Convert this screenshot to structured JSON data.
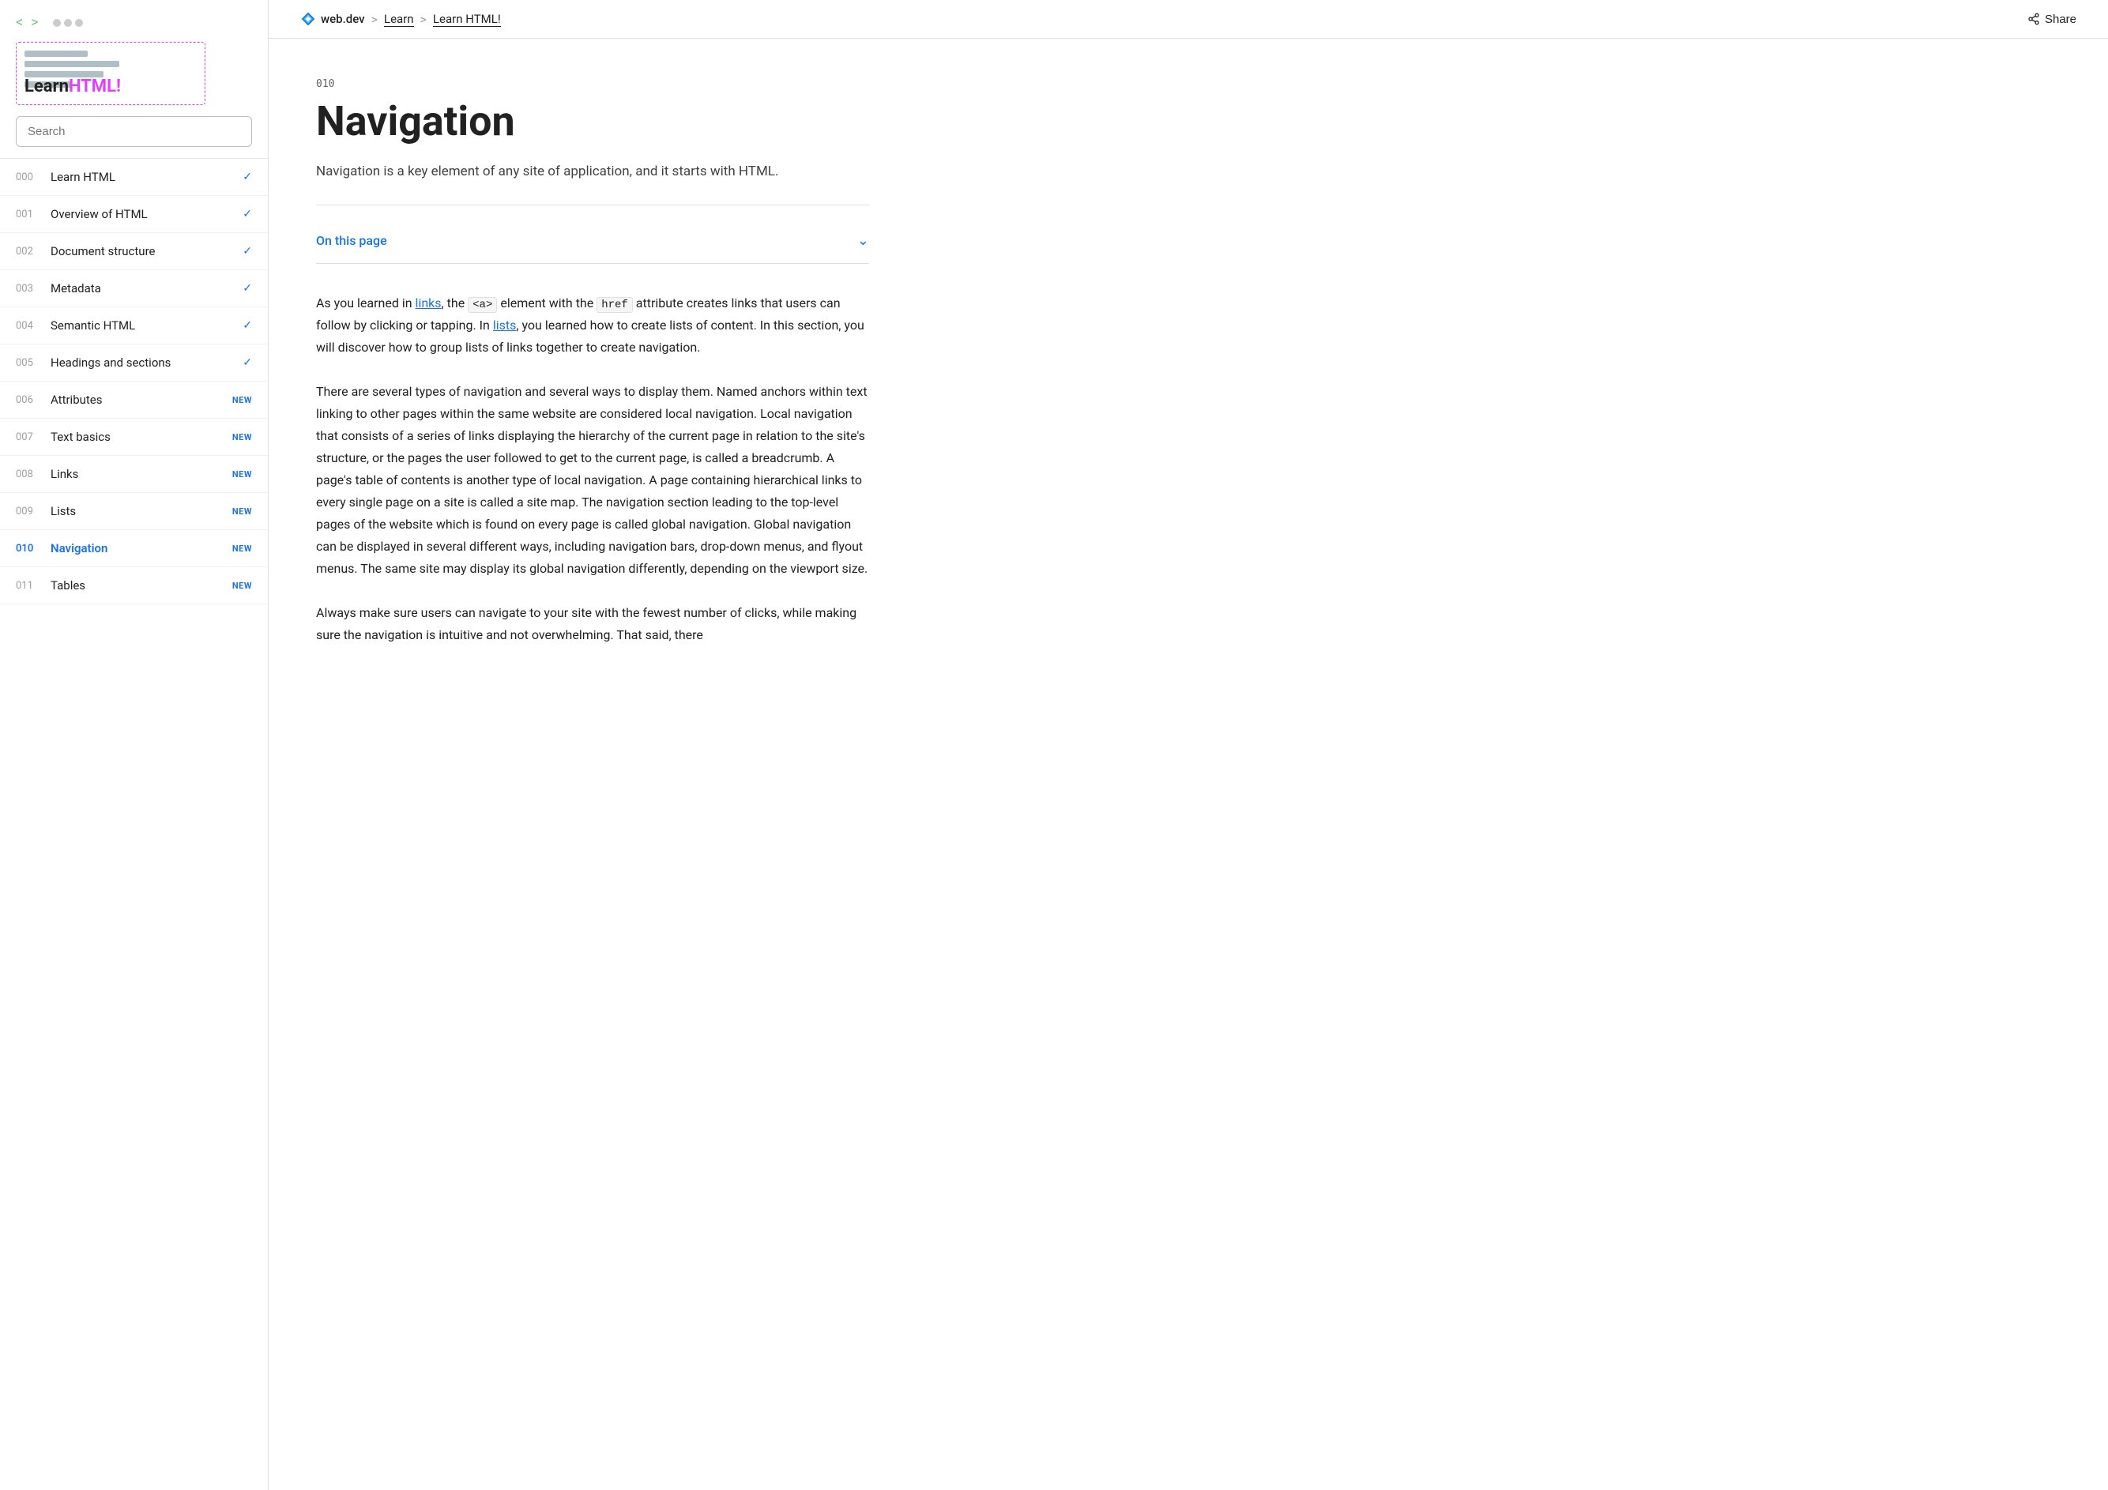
{
  "topbar": {
    "brand": "web.dev",
    "breadcrumb_sep1": ">",
    "breadcrumb_learn": "Learn",
    "breadcrumb_sep2": ">",
    "breadcrumb_course": "Learn HTML!",
    "share_label": "Share"
  },
  "sidebar": {
    "logo_learn": "Learn",
    "logo_html": "HTML!",
    "search_placeholder": "Search",
    "nav_items": [
      {
        "num": "000",
        "label": "Learn HTML",
        "status": "check"
      },
      {
        "num": "001",
        "label": "Overview of HTML",
        "status": "check"
      },
      {
        "num": "002",
        "label": "Document structure",
        "status": "check"
      },
      {
        "num": "003",
        "label": "Metadata",
        "status": "check"
      },
      {
        "num": "004",
        "label": "Semantic HTML",
        "status": "check"
      },
      {
        "num": "005",
        "label": "Headings and sections",
        "status": "check"
      },
      {
        "num": "006",
        "label": "Attributes",
        "status": "new"
      },
      {
        "num": "007",
        "label": "Text basics",
        "status": "new"
      },
      {
        "num": "008",
        "label": "Links",
        "status": "new"
      },
      {
        "num": "009",
        "label": "Lists",
        "status": "new"
      },
      {
        "num": "010",
        "label": "Navigation",
        "status": "new",
        "active": true
      },
      {
        "num": "011",
        "label": "Tables",
        "status": "new"
      }
    ]
  },
  "content": {
    "lesson_num": "010",
    "title": "Navigation",
    "subtitle": "Navigation is a key element of any site of application, and it starts with HTML.",
    "on_this_page": "On this page",
    "body1": "As you learned in links, the <a> element with the href attribute creates links that users can follow by clicking or tapping. In lists, you learned how to create lists of content. In this section, you will discover how to group lists of links together to create navigation.",
    "body2": "There are several types of navigation and several ways to display them. Named anchors within text linking to other pages within the same website are considered local navigation. Local navigation that consists of a series of links displaying the hierarchy of the current page in relation to the site's structure, or the pages the user followed to get to the current page, is called a breadcrumb. A page's table of contents is another type of local navigation. A page containing hierarchical links to every single page on a site is called a site map. The navigation section leading to the top-level pages of the website which is found on every page is called global navigation. Global navigation can be displayed in several different ways, including navigation bars, drop-down menus, and flyout menus. The same site may display its global navigation differently, depending on the viewport size.",
    "body3": "Always make sure users can navigate to your site with the fewest number of clicks, while making sure the navigation is intuitive and not overwhelming. That said, there",
    "inline_link1": "links",
    "inline_link2": "lists",
    "code1": "<a>",
    "code2": "href"
  }
}
